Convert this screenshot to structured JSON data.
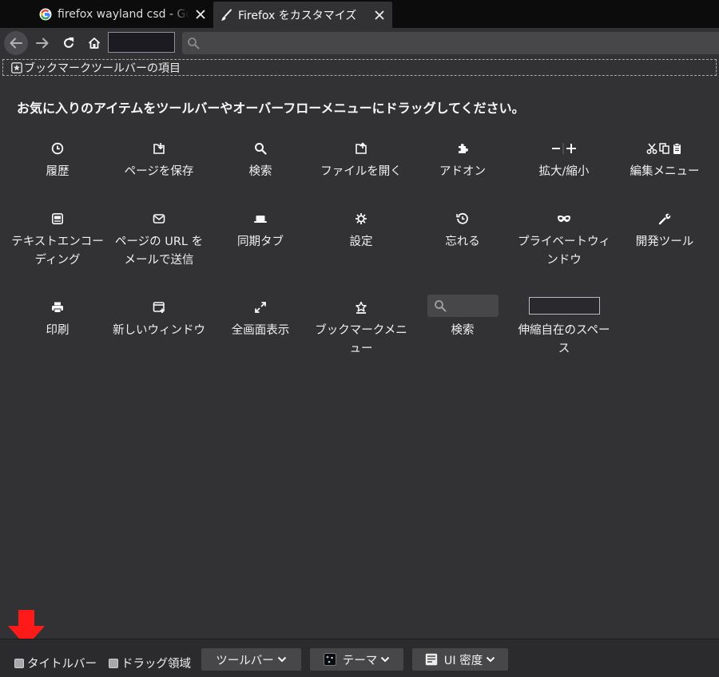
{
  "tabs": [
    {
      "title": "firefox wayland csd - Goo",
      "favicon": "google-icon",
      "close": "close-icon"
    },
    {
      "title": "Firefox をカスタマイズ",
      "favicon": "brush-icon",
      "close": "close-icon"
    }
  ],
  "navbar": {
    "back": "back-arrow-icon",
    "forward": "forward-arrow-icon",
    "reload": "reload-icon",
    "home": "home-icon",
    "urlbar_icon": "search-icon"
  },
  "bookmarks_toolbar": {
    "label": "ブックマークツールバーの項目",
    "icon": "star-bookmark-icon"
  },
  "palette": {
    "heading": "お気に入りのアイテムをツールバーやオーバーフローメニューにドラッグしてください。",
    "items": [
      {
        "label": "履歴",
        "icon": "clock-icon"
      },
      {
        "label": "ページを保存",
        "icon": "save-page-icon"
      },
      {
        "label": "検索",
        "icon": "search-icon"
      },
      {
        "label": "ファイルを開く",
        "icon": "open-file-icon"
      },
      {
        "label": "アドオン",
        "icon": "puzzle-icon"
      },
      {
        "label": "拡大/縮小",
        "icon": "zoom-icon"
      },
      {
        "label": "編集メニュー",
        "icon": "edit-controls-icon"
      },
      {
        "label": "テキストエンコーディング",
        "icon": "text-encoding-icon"
      },
      {
        "label": "ページの URL をメールで送信",
        "icon": "mail-icon"
      },
      {
        "label": "同期タブ",
        "icon": "synced-tabs-icon"
      },
      {
        "label": "設定",
        "icon": "gear-icon"
      },
      {
        "label": "忘れる",
        "icon": "forget-icon"
      },
      {
        "label": "プライベートウィンドウ",
        "icon": "private-mask-icon"
      },
      {
        "label": "開発ツール",
        "icon": "wrench-icon"
      },
      {
        "label": "印刷",
        "icon": "printer-icon"
      },
      {
        "label": "新しいウィンドウ",
        "icon": "new-window-icon"
      },
      {
        "label": "全画面表示",
        "icon": "fullscreen-icon"
      },
      {
        "label": "ブックマークメニュー",
        "icon": "bookmark-menu-icon"
      },
      {
        "label": "検索",
        "icon": "search-box-icon"
      },
      {
        "label": "伸縮自在のスペース",
        "icon": "flexible-space-icon"
      }
    ]
  },
  "footer": {
    "titlebar_label": "タイトルバー",
    "titlebar_checked": false,
    "dragspace_label": "ドラッグ領域",
    "dragspace_checked": false,
    "toolbars_label": "ツールバー",
    "theme_label": "テーマ",
    "density_label": "UI 密度"
  },
  "colors": {
    "background": "#323234",
    "tabstrip": "#0c0c0d",
    "text": "#f9f9fa",
    "button": "#474749",
    "annotation_arrow": "#ff1a1a"
  }
}
